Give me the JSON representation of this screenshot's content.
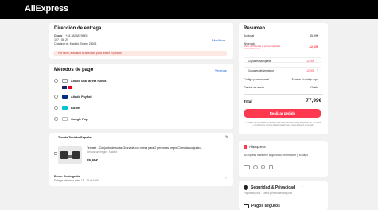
{
  "header": {
    "logo": "AliExpress"
  },
  "address": {
    "title": "Dirección de entrega",
    "name": "Chofo",
    "phone": "+34 3823879845",
    "line1": "197 f 56 29",
    "line2": "Chapinería, Madrid, Spain, 28001",
    "edit_label": "Modificar",
    "warning": "Por favor, actualiza tu dirección para recibir el pedido"
  },
  "payment": {
    "title": "Métodos de pago",
    "more_label": "Ver más",
    "methods": [
      {
        "label": "Añadir una tarjeta nueva",
        "icon": "card-icon"
      },
      {
        "label": "Añadir PayPal",
        "icon": "paypal-icon"
      },
      {
        "label": "Bizum",
        "icon": "bizum-icon"
      },
      {
        "label": "Google Pay",
        "icon": "googlepay-icon"
      }
    ]
  },
  "store": {
    "name": "Tienda Teniake España",
    "product_title": "Teniake - Conjunto de sofás Granada con mesa para 2 personas negro Cómoda conjunto...",
    "product_variant": "Gris oscuro/negro · Madrid",
    "price": "85,95€",
    "quantity": "1",
    "shipping_title": "Envío: Envío gratis",
    "shipping_detail": "Entrega estimada entre 15 - 18 de MAY"
  },
  "summary": {
    "title": "Resumen",
    "subtotal_label": "Subtotal",
    "subtotal_value": "85,99€",
    "saved_label": "Ahorrado",
    "saved_note": "Ahorr. 20% desde el primer, aplicable automáticamente",
    "saved_value": "-12,00€",
    "coupon1_label": "Cupones AliExpress",
    "coupon1_value": "-12,00€",
    "coupon2_label": "Cupones del vendedor",
    "coupon2_value": "-12,00€",
    "promo_label": "Código promocional",
    "promo_value": "Escribe el código aquí",
    "shipping_label": "Gastos de envío",
    "shipping_value": "Gratis",
    "total_label": "Total",
    "total_value": "77,99€",
    "cta_label": "Realizar pedido",
    "legal": "Al hacer clic en Realizar pedido, confirmas que has leído y aceptado las Términos y condiciones. Revisa la información para consumidores en la web."
  },
  "trust": {
    "brand": "AliExpress",
    "text": "AliExpress mantiene seguros tu información y tu pago",
    "security_title": "Seguridad & Privacidad",
    "security_sub": "Pagos seguros · Datos personales seguros",
    "payments_title": "Pagos seguros"
  }
}
